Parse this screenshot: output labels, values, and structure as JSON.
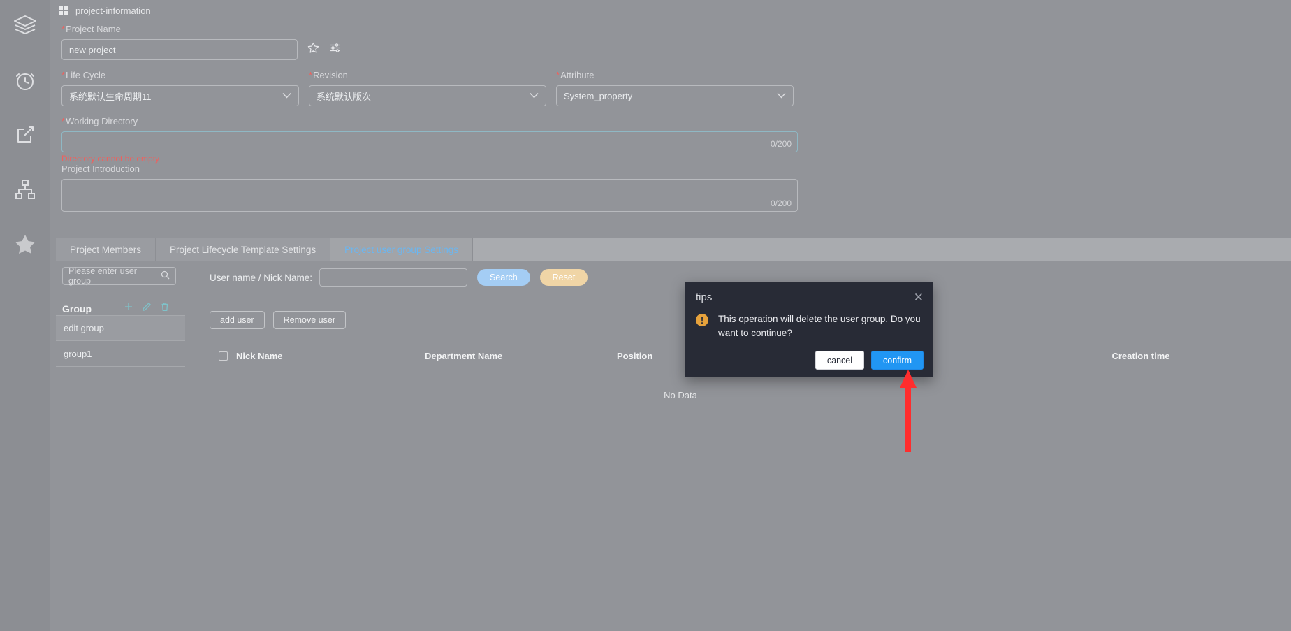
{
  "sidebar": {
    "items": [
      {
        "name": "layers-icon",
        "label": "Layers"
      },
      {
        "name": "alarm-clock-icon",
        "label": "Schedule"
      },
      {
        "name": "share-export-icon",
        "label": "Export"
      },
      {
        "name": "sitemap-icon",
        "label": "Structure"
      },
      {
        "name": "star-icon",
        "label": "Favorites"
      }
    ]
  },
  "breadcrumb": {
    "icon": "grid-icon",
    "text": "project-information"
  },
  "form": {
    "project_name": {
      "label": "Project Name",
      "required": "*",
      "value": "new project"
    },
    "favorite_icon": "star-outline-icon",
    "settings_icon": "sliders-icon",
    "life_cycle": {
      "label": "Life Cycle",
      "required": "*",
      "value": "系统默认生命周期11"
    },
    "revision": {
      "label": "Revision",
      "required": "*",
      "value": "系统默认版次"
    },
    "attribute": {
      "label": "Attribute",
      "required": "*",
      "value": "System_property"
    },
    "working_directory": {
      "label": "Working Directory",
      "required": "*",
      "value": "",
      "counter": "0/200",
      "error": "Directory cannot be empty"
    },
    "project_introduction": {
      "label": "Project Introduction",
      "value": "",
      "counter": "0/200"
    }
  },
  "tabs": [
    {
      "label": "Project Members",
      "active": false
    },
    {
      "label": "Project Lifecycle Template Settings",
      "active": false
    },
    {
      "label": "Project user group Settings",
      "active": true
    }
  ],
  "group_panel": {
    "search_placeholder": "Please enter user group",
    "search_icon": "search-icon",
    "heading": "Group",
    "actions": [
      {
        "name": "add-group-icon",
        "glyph": "+"
      },
      {
        "name": "edit-group-icon",
        "glyph": "pencil"
      },
      {
        "name": "delete-group-icon",
        "glyph": "trash"
      }
    ],
    "items": [
      {
        "label": "edit group",
        "selected": true
      },
      {
        "label": "group1",
        "selected": false
      }
    ]
  },
  "user_panel": {
    "search_label": "User name / Nick Name:",
    "search_value": "",
    "search_button": "Search",
    "reset_button": "Reset",
    "add_user_button": "add user",
    "remove_user_button": "Remove user",
    "table": {
      "columns": [
        "Nick Name",
        "Department Name",
        "Position",
        "",
        "Creation time"
      ],
      "rows": [],
      "empty_text": "No Data"
    }
  },
  "dialog": {
    "title": "tips",
    "close_icon": "close-icon",
    "warning_icon": "warning-icon",
    "message": "This operation will delete the user group. Do you want to continue?",
    "cancel_label": "cancel",
    "confirm_label": "confirm"
  },
  "annotation": {
    "arrow_color": "#ff2d2d",
    "target": "confirm-button"
  },
  "colors": {
    "page_bg": "#929499",
    "rail_bg": "#8c8e93",
    "accent_blue": "#2196f3",
    "tab_active_text": "#6cb6ef",
    "error_red": "#f0605d",
    "search_pill": "#a4cdf4",
    "reset_pill": "#f0d5a6",
    "dialog_bg": "#282b36",
    "warning_orange": "#e6a23c"
  }
}
